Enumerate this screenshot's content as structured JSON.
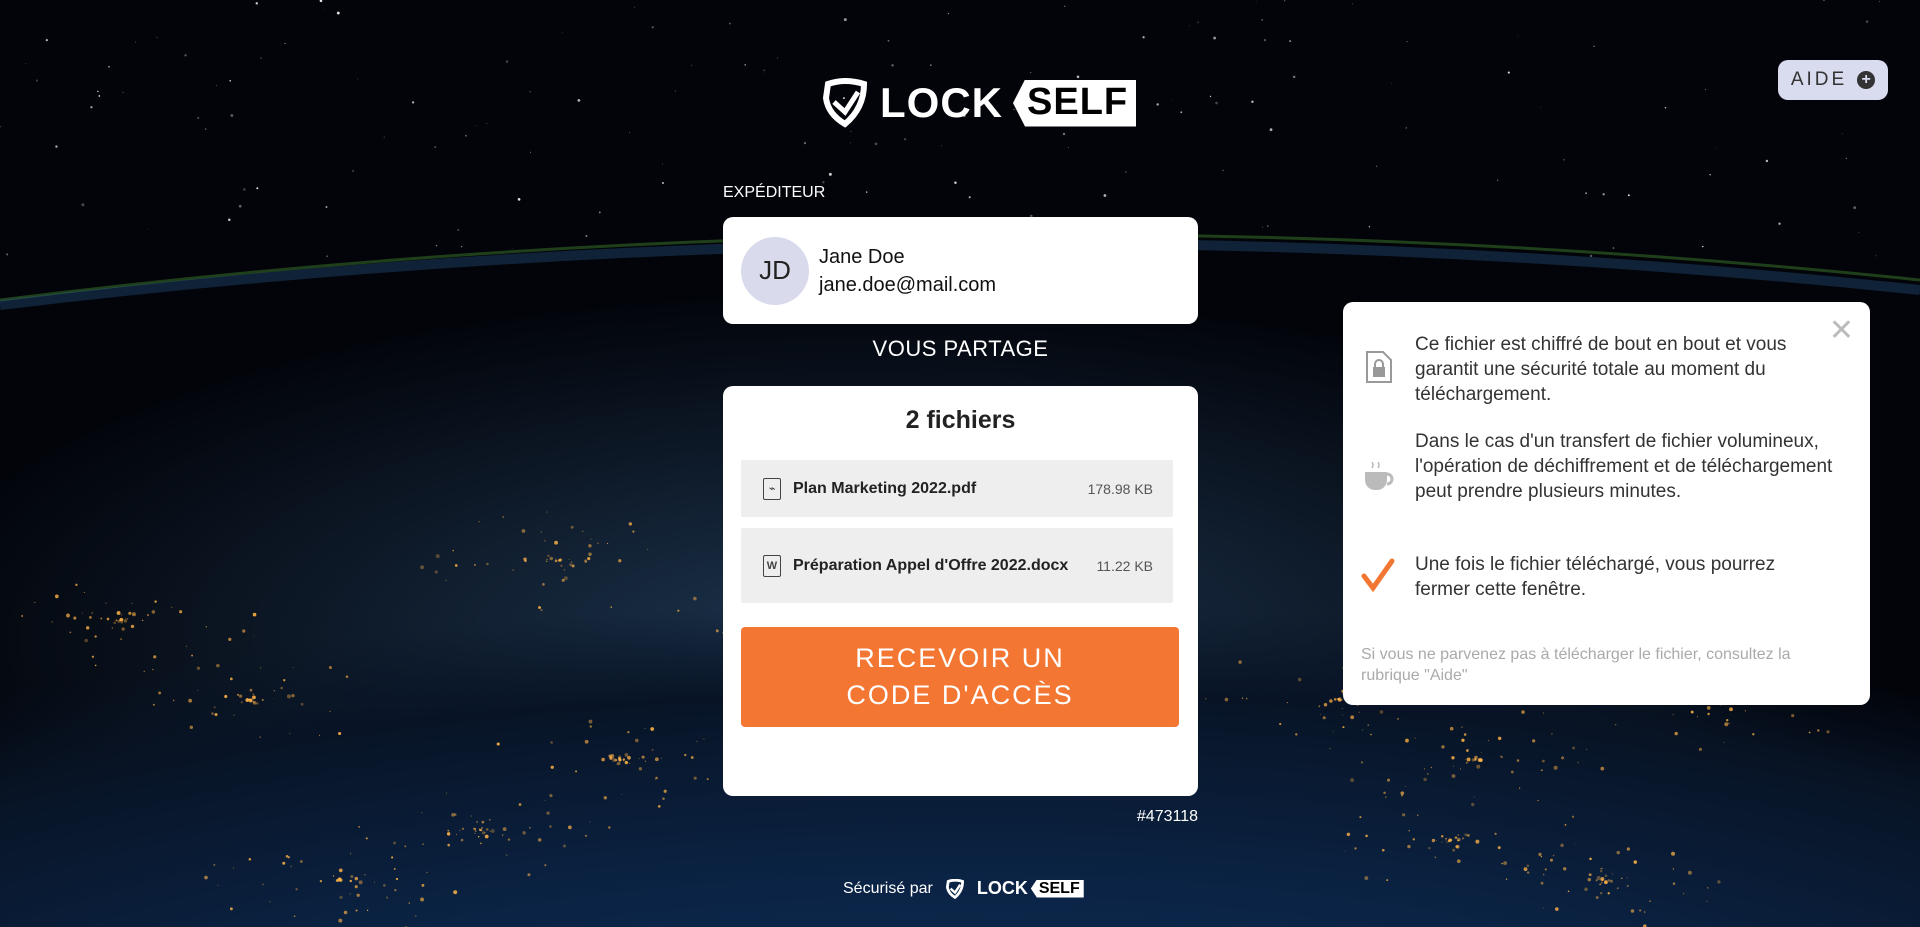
{
  "brand": {
    "lock": "LOCK",
    "self": "SELF"
  },
  "help": {
    "label": "AIDE",
    "icon": "plus-circle-icon"
  },
  "sender": {
    "section_label": "EXPÉDITEUR",
    "initials": "JD",
    "name": "Jane Doe",
    "email": "jane.doe@mail.com"
  },
  "shares_label": "VOUS PARTAGE",
  "files": {
    "title": "2 fichiers",
    "items": [
      {
        "name": "Plan Marketing 2022.pdf",
        "size": "178.98 KB",
        "icon": "pdf-file-icon"
      },
      {
        "name": "Préparation Appel d'Offre 2022.docx",
        "size": "11.22 KB",
        "icon": "word-file-icon"
      }
    ],
    "cta_label": "RECEVOIR UN CODE D'ACCÈS"
  },
  "reference": "#473118",
  "footer": {
    "secured_by": "Sécurisé par"
  },
  "info_panel": {
    "items": [
      {
        "icon": "lock-file-icon",
        "text": "Ce fichier est chiffré de bout en bout et vous garantit une sécurité totale au moment du téléchargement."
      },
      {
        "icon": "coffee-cup-icon",
        "text": "Dans le cas d'un transfert de fichier volumineux, l'opération de déchiffrement et de téléchargement peut prendre plusieurs minutes."
      },
      {
        "icon": "checkmark-icon",
        "text": "Une fois le fichier téléchargé, vous pourrez fermer cette fenêtre."
      }
    ],
    "note": "Si vous ne parvenez pas à télécharger le fichier, consultez la rubrique \"Aide\""
  },
  "colors": {
    "accent": "#f37733",
    "avatar_bg": "#d9daeb",
    "help_bg": "#d9dbee"
  }
}
